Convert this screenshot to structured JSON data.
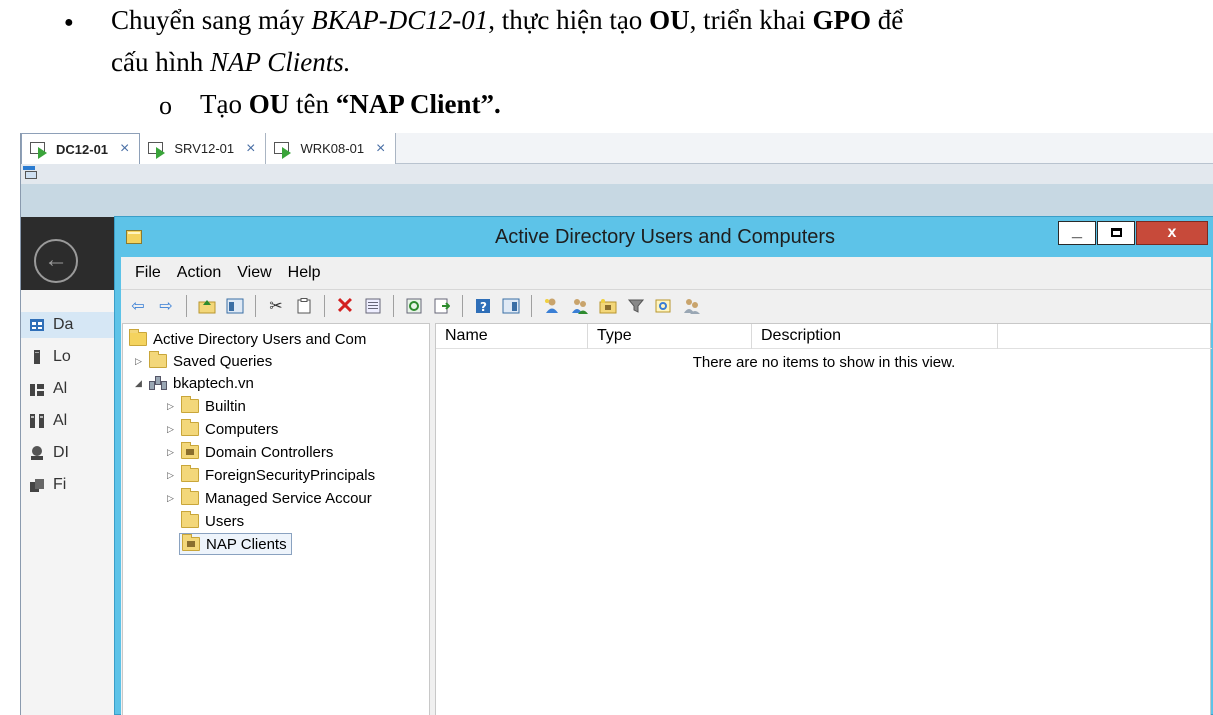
{
  "document": {
    "line1": {
      "p1": "Chuyển sang máy ",
      "machine": "BKAP-DC12-01",
      "p2": ", thực hiện tạo ",
      "ou": "OU",
      "p3": ", triển khai ",
      "gpo": "GPO",
      "p4": " để"
    },
    "line2": {
      "p1": "cấu hình ",
      "nap": "NAP Clients."
    },
    "line3": {
      "p1": "Tạo ",
      "ou": "OU",
      "p2": " tên ",
      "name": "“NAP Client”."
    },
    "bullet_filled": "●",
    "bullet_hollow": "o"
  },
  "vm_tabs": [
    {
      "label": "DC12-01",
      "active": true
    },
    {
      "label": "SRV12-01",
      "active": false
    },
    {
      "label": "WRK08-01",
      "active": false
    }
  ],
  "tab_close_glyph": "×",
  "server_manager_nav": [
    {
      "label": "Da",
      "icon": "dashboard-icon"
    },
    {
      "label": "Lo",
      "icon": "local-server-icon"
    },
    {
      "label": "Al",
      "icon": "all-servers-icon"
    },
    {
      "label": "Al",
      "icon": "ad-icon"
    },
    {
      "label": "DI",
      "icon": "dns-icon"
    },
    {
      "label": "Fi",
      "icon": "file-services-icon"
    }
  ],
  "window": {
    "title": "Active Directory Users and Computers",
    "min_glyph": "_",
    "close_glyph": "x"
  },
  "menu": [
    "File",
    "Action",
    "View",
    "Help"
  ],
  "tree": {
    "root": "Active Directory Users and Com",
    "saved_queries": "Saved Queries",
    "domain": "bkaptech.vn",
    "children": [
      "Builtin",
      "Computers",
      "Domain Controllers",
      "ForeignSecurityPrincipals",
      "Managed Service Accour",
      "Users",
      "NAP Clients"
    ]
  },
  "list": {
    "columns": [
      "Name",
      "Type",
      "Description"
    ],
    "empty_message": "There are no items to show in this view."
  },
  "colors": {
    "window_frame": "#5dc3e8",
    "close_button": "#c74a3a",
    "dark_band": "#2c2c2c"
  }
}
